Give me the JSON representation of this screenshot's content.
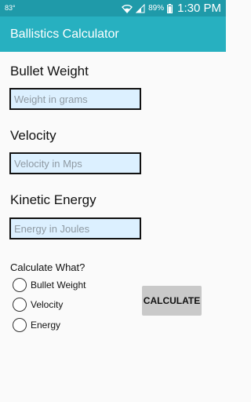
{
  "status_bar": {
    "notification": "83°",
    "battery": "89%",
    "time": "1:30 PM",
    "icons": [
      "wifi-icon",
      "signal-icon",
      "battery-icon"
    ]
  },
  "app_bar": {
    "title": "Ballistics Calculator",
    "color": "#27b0c0"
  },
  "form": {
    "bullet_weight": {
      "label": "Bullet Weight",
      "placeholder": "Weight in grams",
      "value": ""
    },
    "velocity": {
      "label": "Velocity",
      "placeholder": "Velocity in Mps",
      "value": ""
    },
    "kinetic_energy": {
      "label": "Kinetic Energy",
      "placeholder": "Energy in Joules",
      "value": ""
    }
  },
  "calculate": {
    "prompt": "Calculate What?",
    "options": [
      {
        "label": "Bullet Weight",
        "selected": false
      },
      {
        "label": "Velocity",
        "selected": false
      },
      {
        "label": "Energy",
        "selected": false
      }
    ],
    "button_label": "CALCULATE"
  }
}
